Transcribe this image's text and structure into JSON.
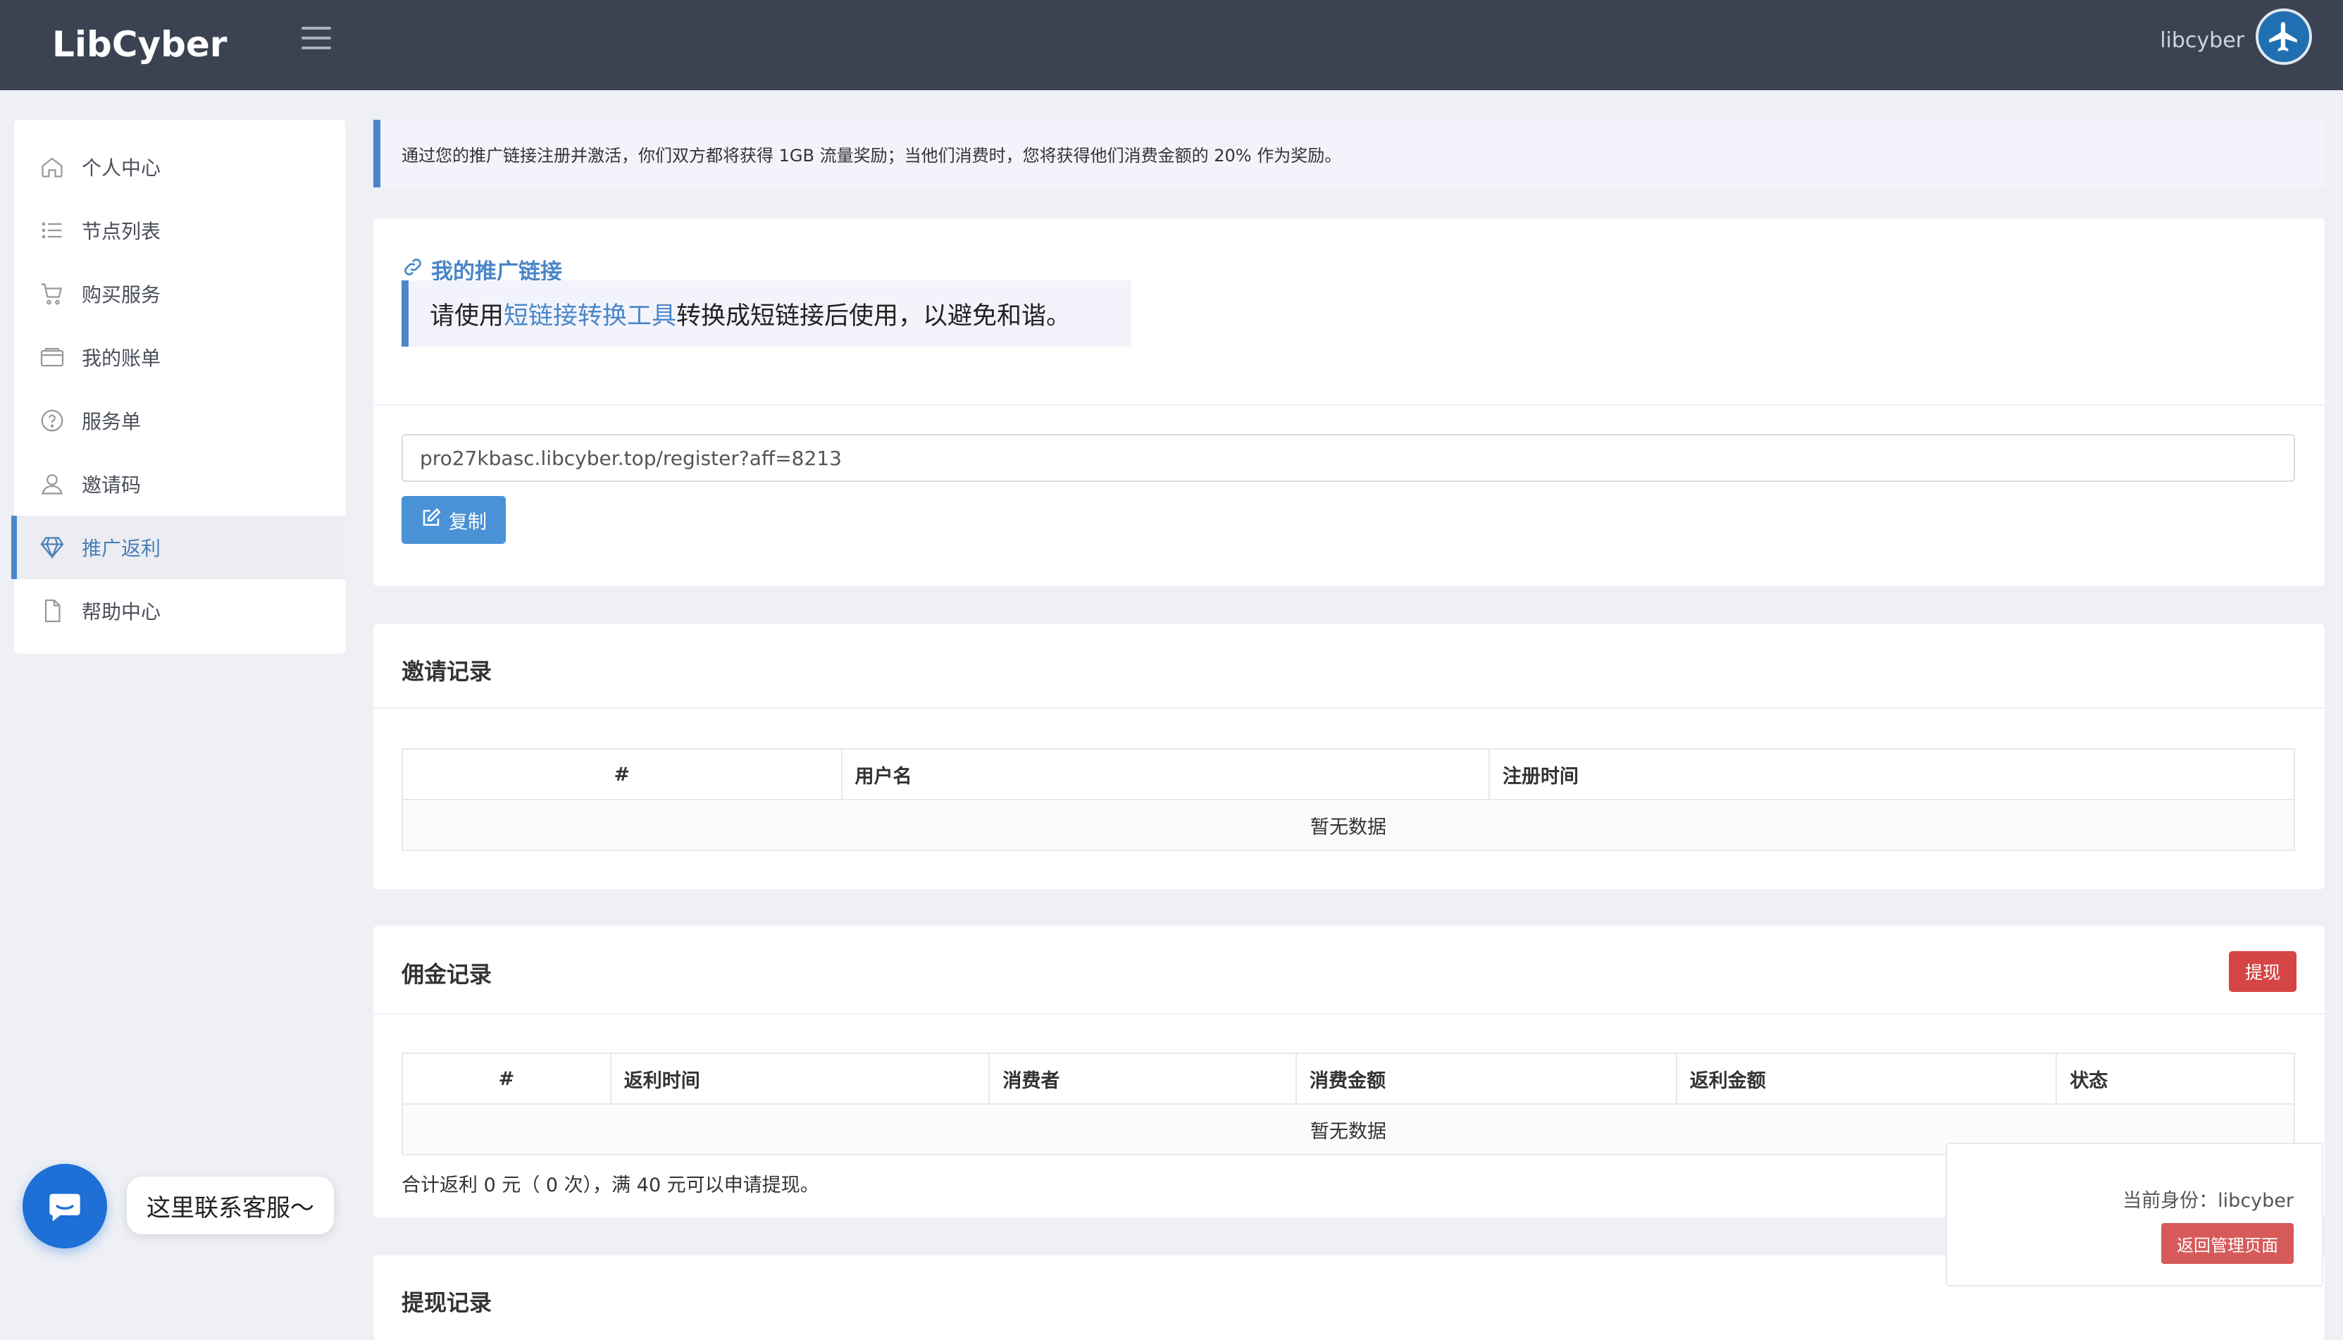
{
  "header": {
    "logo": "LibCyber",
    "username": "libcyber"
  },
  "sidebar": {
    "items": [
      {
        "label": "个人中心",
        "icon": "home-icon"
      },
      {
        "label": "节点列表",
        "icon": "list-icon"
      },
      {
        "label": "购买服务",
        "icon": "cart-icon"
      },
      {
        "label": "我的账单",
        "icon": "wallet-icon"
      },
      {
        "label": "服务单",
        "icon": "question-icon"
      },
      {
        "label": "邀请码",
        "icon": "user-icon"
      },
      {
        "label": "推广返利",
        "icon": "diamond-icon",
        "active": true
      },
      {
        "label": "帮助中心",
        "icon": "file-icon"
      }
    ]
  },
  "notice": "通过您的推广链接注册并激活，你们双方都将获得 1GB 流量奖励；当他们消费时，您将获得他们消费金额的 20% 作为奖励。",
  "referral": {
    "title": "我的推广链接",
    "hint_prefix": "请使用",
    "hint_link": "短链接转换工具",
    "hint_suffix": "转换成短链接后使用，以避免和谐。",
    "url": "pro27kbasc.libcyber.top/register?aff=8213",
    "copy_label": "复制"
  },
  "invites": {
    "title": "邀请记录",
    "columns": [
      "#",
      "用户名",
      "注册时间"
    ],
    "empty": "暂无数据"
  },
  "commission": {
    "title": "佣金记录",
    "withdraw_label": "提现",
    "columns": [
      "#",
      "返利时间",
      "消费者",
      "消费金额",
      "返利金额",
      "状态"
    ],
    "empty": "暂无数据",
    "summary": "合计返利 0 元（ 0 次），满 40 元可以申请提现。"
  },
  "withdrawals": {
    "title": "提现记录"
  },
  "admin_panel": {
    "identity": "当前身份：libcyber",
    "back_label": "返回管理页面"
  },
  "chat": {
    "bubble": "这里联系客服～"
  },
  "colors": {
    "topbar": "#3b4252",
    "accent": "#4a86c8",
    "danger": "#d64545",
    "background": "#eef0f5"
  }
}
